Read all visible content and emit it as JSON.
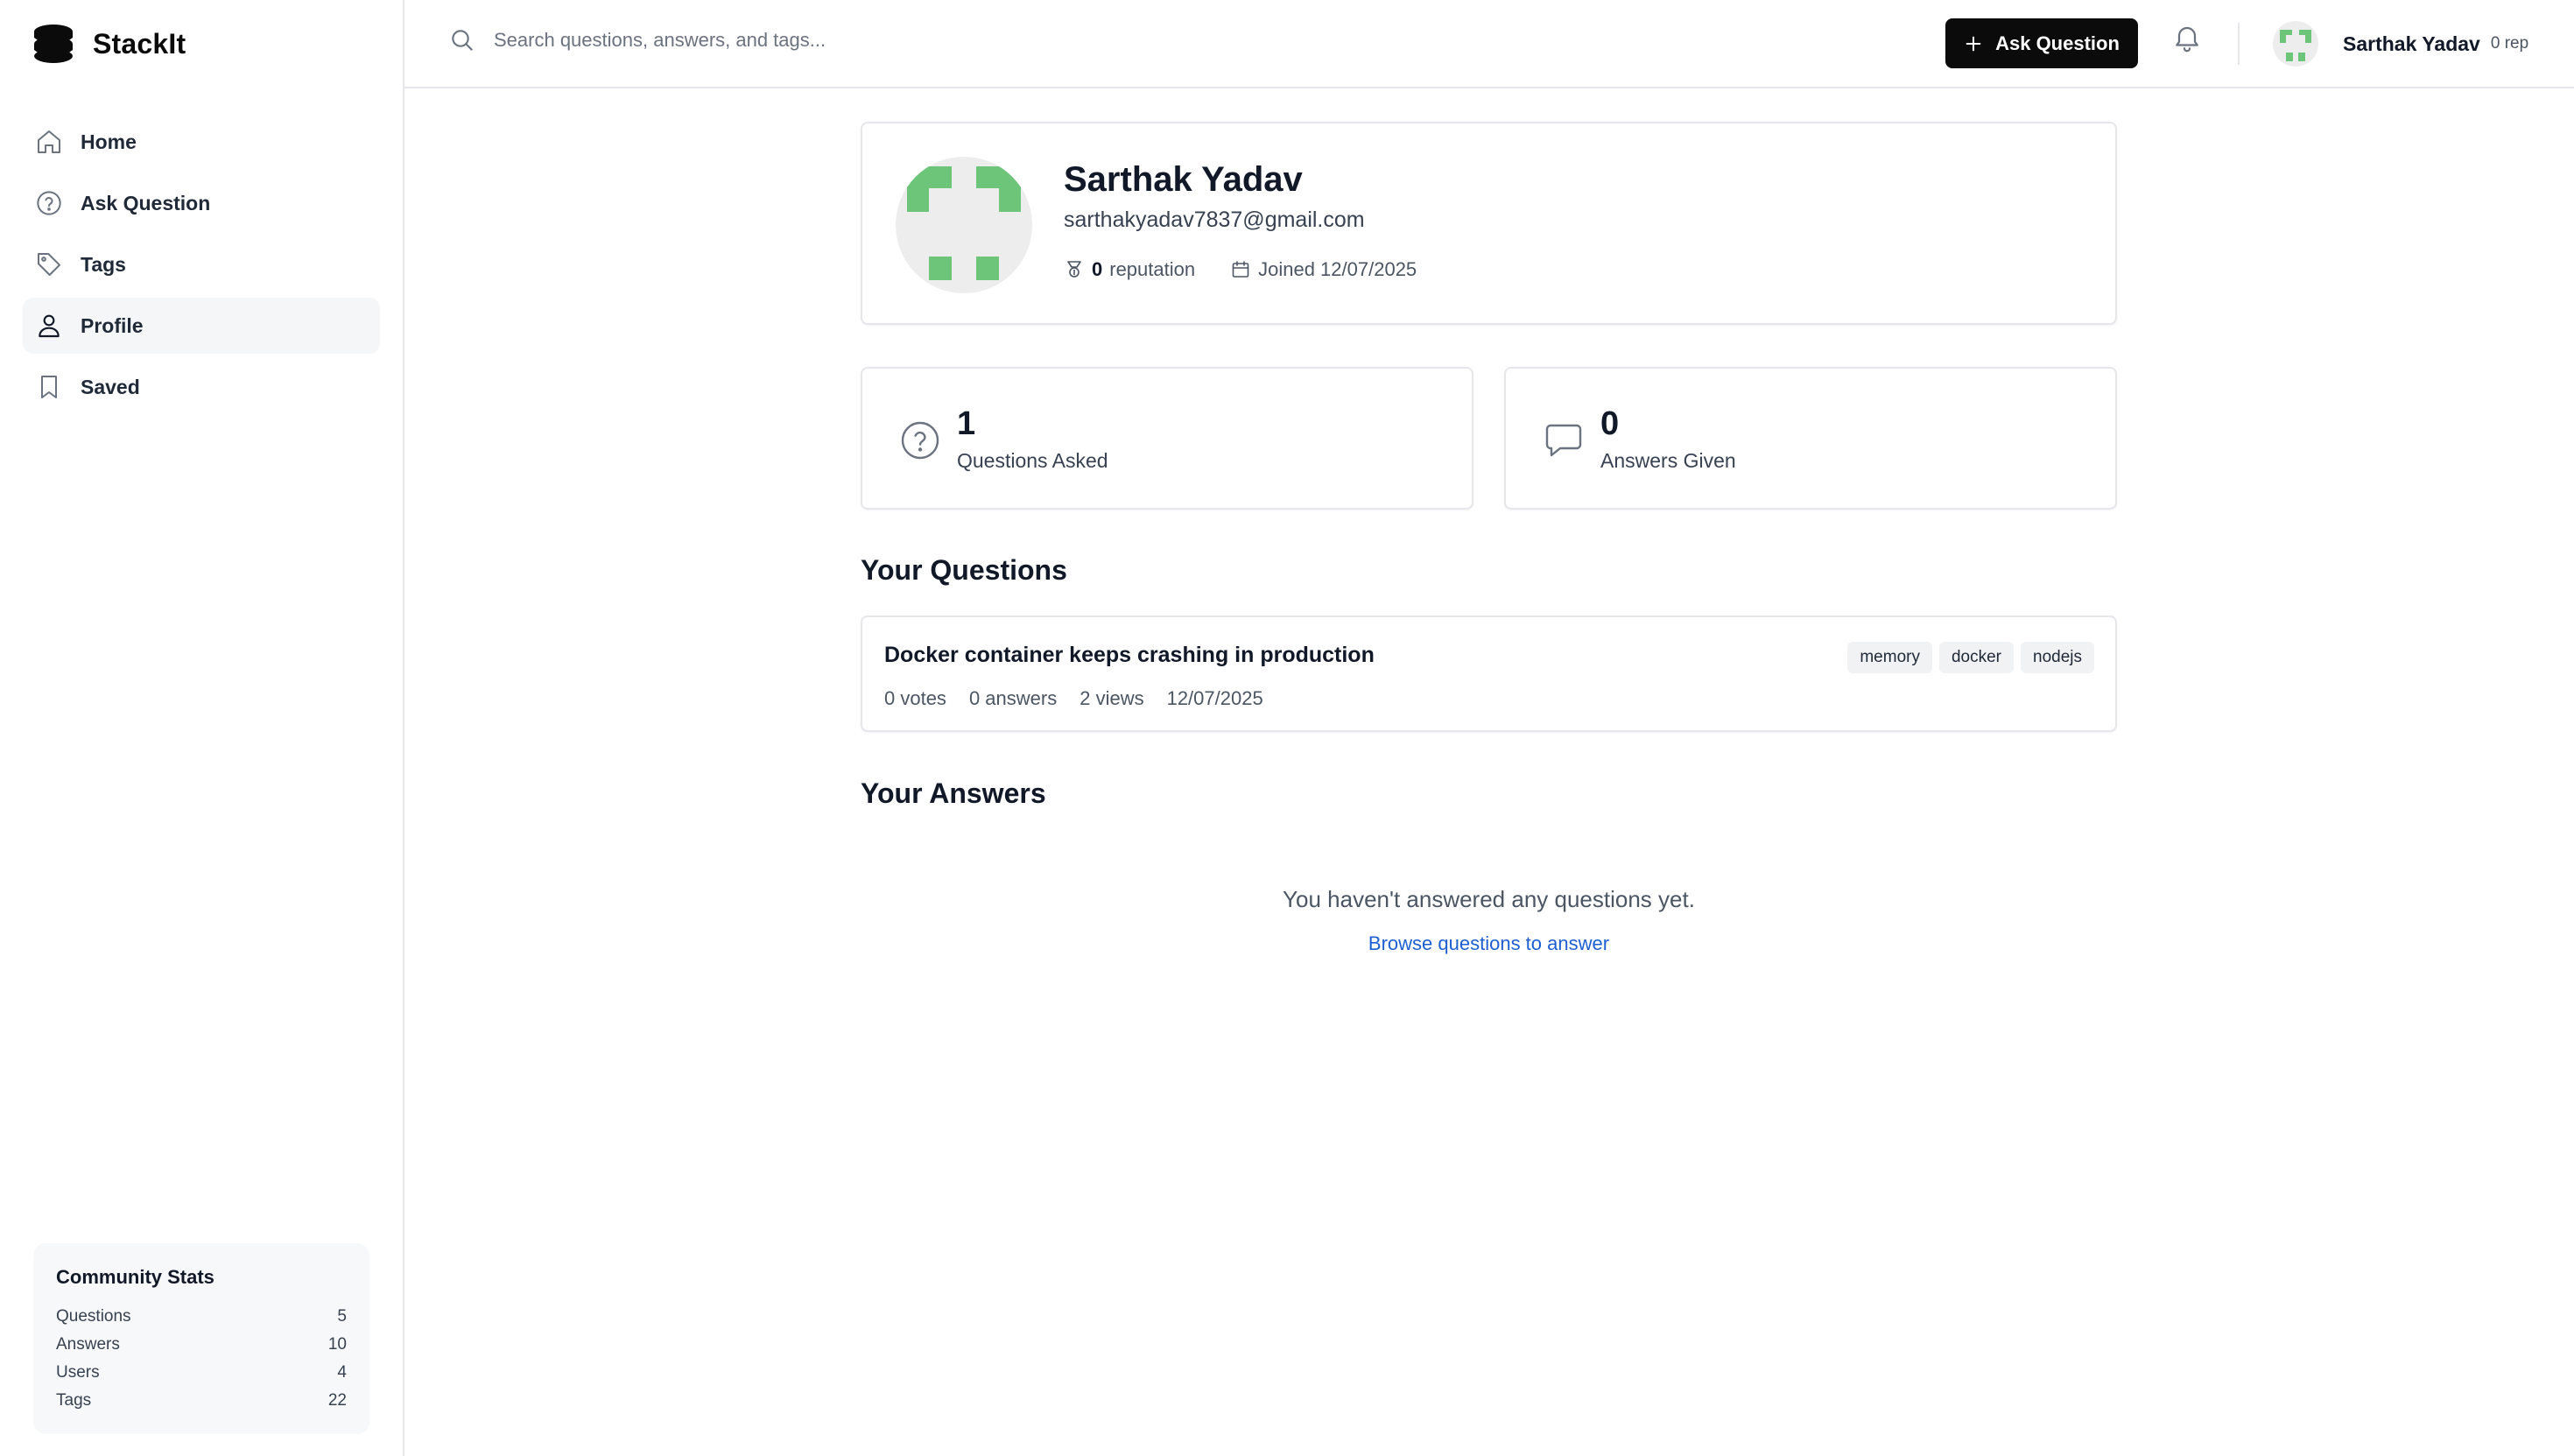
{
  "app": {
    "name": "StackIt"
  },
  "sidebar": {
    "items": [
      {
        "label": "Home",
        "icon": "home-icon",
        "active": false
      },
      {
        "label": "Ask Question",
        "icon": "question-circle-icon",
        "active": false
      },
      {
        "label": "Tags",
        "icon": "tag-icon",
        "active": false
      },
      {
        "label": "Profile",
        "icon": "user-icon",
        "active": true
      },
      {
        "label": "Saved",
        "icon": "bookmark-icon",
        "active": false
      }
    ],
    "community_stats": {
      "title": "Community Stats",
      "rows": [
        {
          "label": "Questions",
          "value": "5"
        },
        {
          "label": "Answers",
          "value": "10"
        },
        {
          "label": "Users",
          "value": "4"
        },
        {
          "label": "Tags",
          "value": "22"
        }
      ]
    }
  },
  "header": {
    "search": {
      "placeholder": "Search questions, answers, and tags...",
      "value": ""
    },
    "ask_button_label": "Ask Question",
    "user": {
      "name": "Sarthak Yadav",
      "rep": "0 rep"
    }
  },
  "profile": {
    "name": "Sarthak Yadav",
    "email": "sarthakyadav7837@gmail.com",
    "reputation_value": "0",
    "reputation_label": "reputation",
    "joined": "Joined 12/07/2025"
  },
  "stats": {
    "questions": {
      "value": "1",
      "label": "Questions Asked"
    },
    "answers": {
      "value": "0",
      "label": "Answers Given"
    }
  },
  "your_questions": {
    "title": "Your Questions",
    "items": [
      {
        "title": "Docker container keeps crashing in production",
        "votes": "0 votes",
        "answers": "0 answers",
        "views": "2 views",
        "date": "12/07/2025",
        "tags": [
          "memory",
          "docker",
          "nodejs"
        ]
      }
    ]
  },
  "your_answers": {
    "title": "Your Answers",
    "empty_text": "You haven't answered any questions yet.",
    "browse_link": "Browse questions to answer"
  },
  "colors": {
    "avatar_green": "#6dc57a",
    "avatar_bg": "#ededed",
    "link_blue": "#1d5fd1",
    "primary_button": "#0b0b0b"
  }
}
